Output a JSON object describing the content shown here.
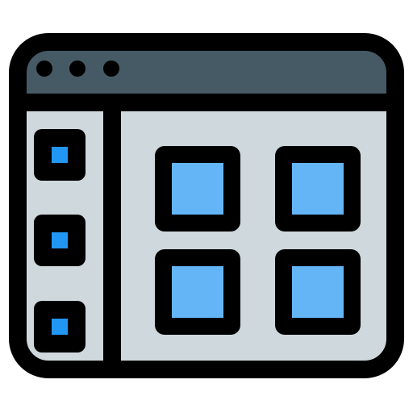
{
  "icon": {
    "name": "app-window-grid-icon",
    "colors": {
      "outline": "#000000",
      "title_bar": "#455A64",
      "window_body": "#CFD8DC",
      "tile_fill": "#64B5F6",
      "sidebar_square": "#2196F3",
      "dot": "#000000"
    },
    "title_bar_dots": 3,
    "sidebar_items": 3,
    "grid_tiles": 4
  }
}
